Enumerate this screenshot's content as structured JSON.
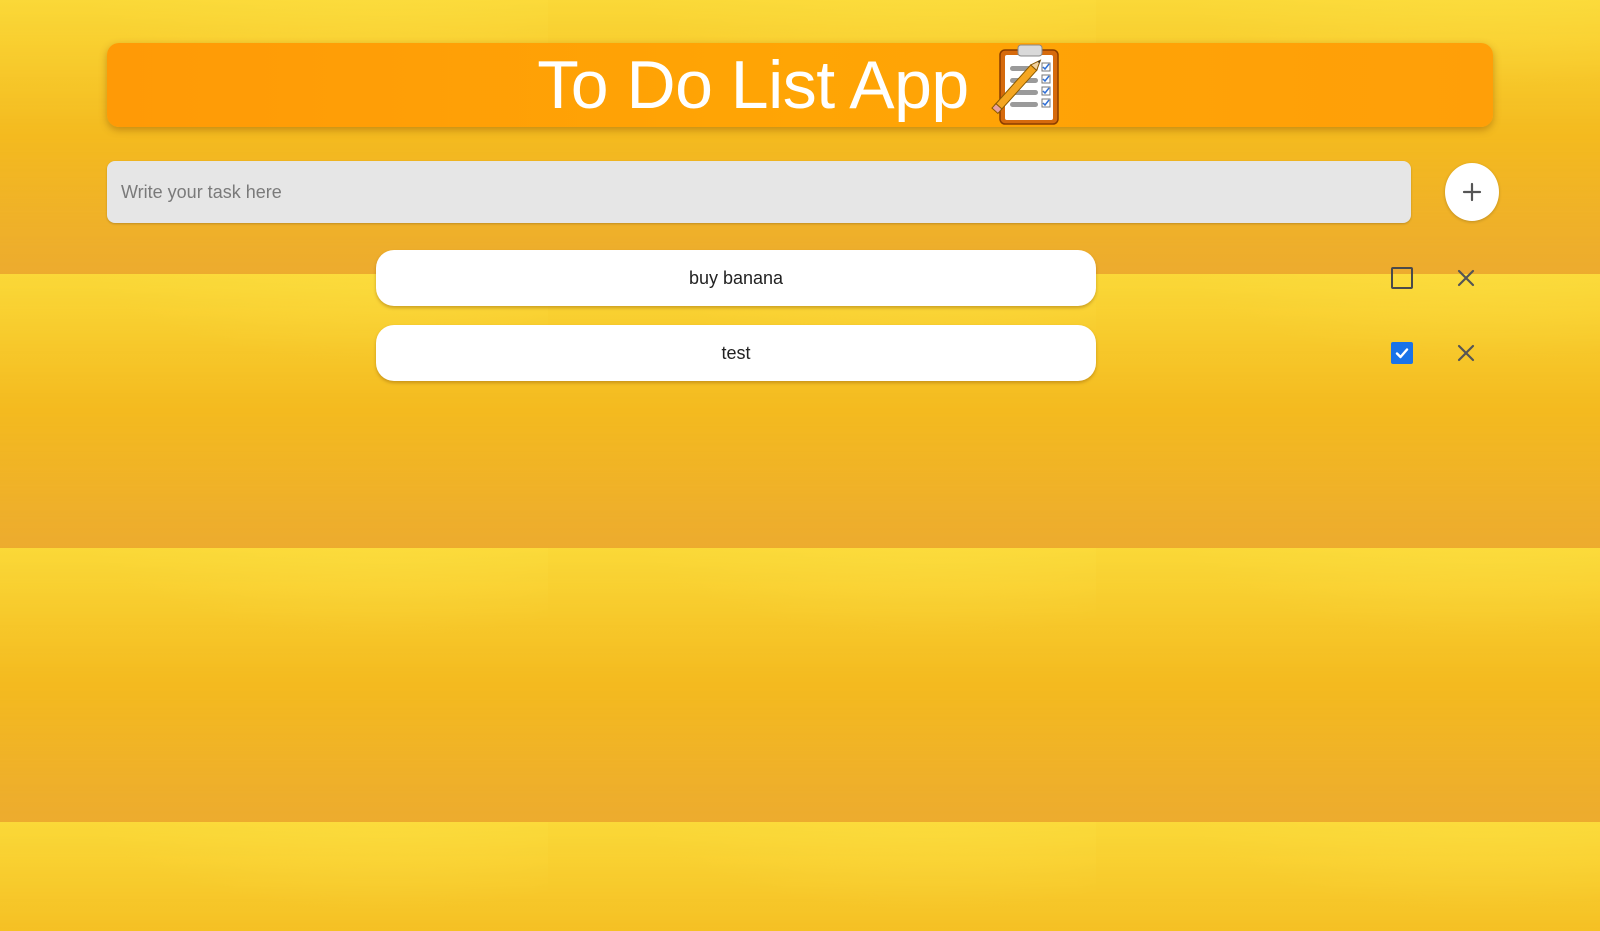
{
  "app": {
    "title": "To Do List App",
    "header_icon": "clipboard-checklist-icon"
  },
  "input": {
    "placeholder": "Write your task here",
    "value": ""
  },
  "add_button": {
    "icon": "plus-icon"
  },
  "tasks": [
    {
      "text": "buy banana",
      "completed": false,
      "delete_icon": "close-icon"
    },
    {
      "text": "test",
      "completed": true,
      "delete_icon": "close-icon"
    }
  ],
  "colors": {
    "header": "#ffa00a",
    "background": "#f5bb1e",
    "checkbox_checked": "#1a73e8"
  }
}
